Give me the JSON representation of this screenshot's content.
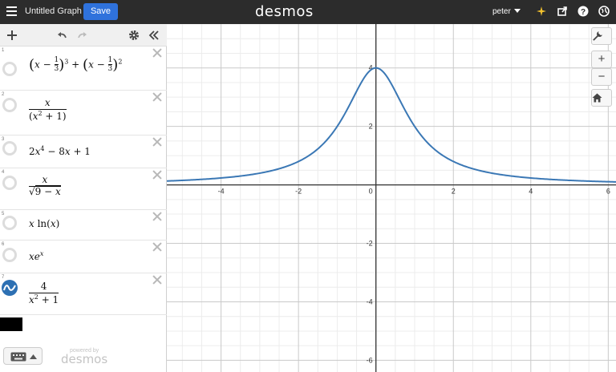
{
  "topbar": {
    "graph_title": "Untitled Graph",
    "save_label": "Save",
    "logo": "desmos",
    "user": "peter"
  },
  "expressions": [
    {
      "index": "1",
      "icon": "empty-circle",
      "latex": "(x − 1/3)³ + (x − 1/3)²"
    },
    {
      "index": "2",
      "icon": "empty-circle",
      "latex": "x / (x² + 1)"
    },
    {
      "index": "3",
      "icon": "empty-circle",
      "latex": "2x⁴ − 8x + 1"
    },
    {
      "index": "4",
      "icon": "empty-circle",
      "latex": "x / √(9 − x)"
    },
    {
      "index": "5",
      "icon": "empty-circle",
      "latex": "x ln(x)"
    },
    {
      "index": "6",
      "icon": "empty-circle",
      "latex": "xeˣ"
    },
    {
      "index": "7",
      "icon": "graph-visible-icon",
      "latex": "4 / (x² + 1)",
      "color": "#2d70b3"
    }
  ],
  "footer": {
    "powered_by": "powered by",
    "brand": "desmos"
  },
  "graph": {
    "x_ticks": [
      "-4",
      "-2",
      "0",
      "2",
      "4",
      "6"
    ],
    "y_ticks": [
      "4",
      "2",
      "-2",
      "-4",
      "-6"
    ],
    "grid": true,
    "curve_color": "#3b78b5"
  },
  "chart_data": {
    "type": "line",
    "xlim": [
      -5.4,
      6.2
    ],
    "ylim": [
      -6.4,
      5.5
    ],
    "series": [
      {
        "expression": "4/(x^2+1)",
        "x": [
          -5.4,
          -4,
          -3,
          -2,
          -1,
          -0.5,
          0,
          0.5,
          1,
          2,
          3,
          4,
          6.2
        ],
        "y": [
          0.13,
          0.24,
          0.4,
          0.8,
          2,
          3.2,
          4,
          3.2,
          2,
          0.8,
          0.4,
          0.24,
          0.1
        ]
      }
    ]
  },
  "colors": {
    "topbar": "#2c2c2c",
    "save": "#2f72dc",
    "curve": "#3b78b5"
  }
}
